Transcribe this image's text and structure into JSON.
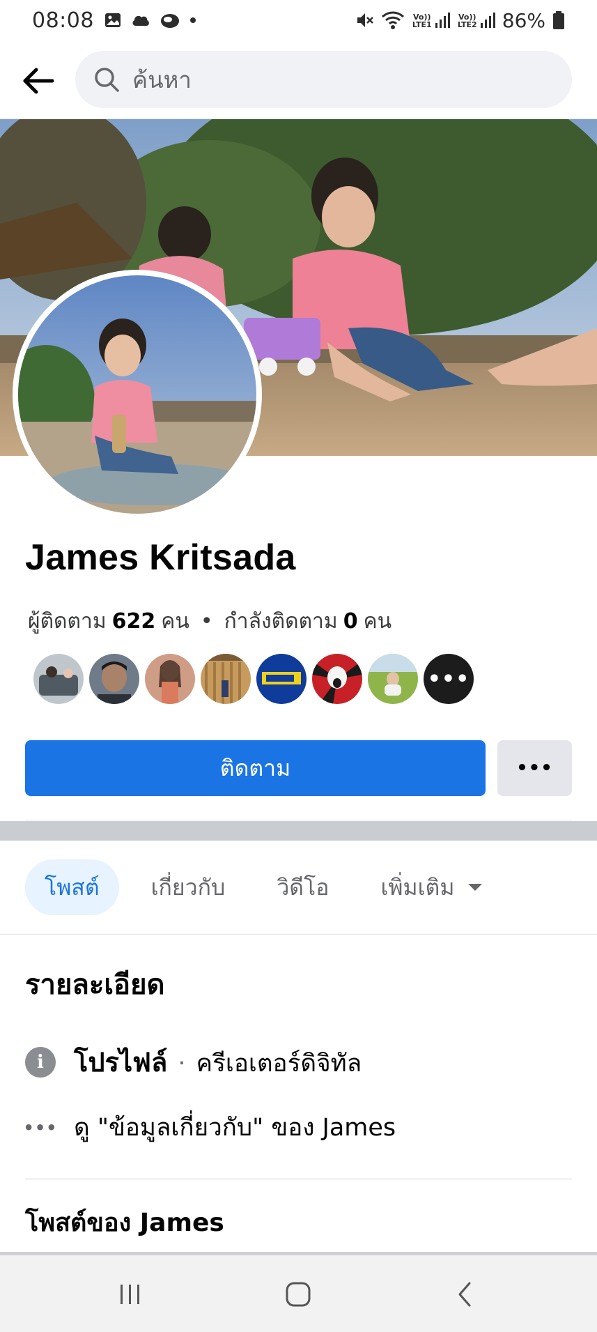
{
  "status_bar": {
    "time": "08:08",
    "battery": "86%",
    "icons": [
      "image-icon",
      "cloud-icon",
      "app-icon",
      "mute-icon",
      "wifi-icon",
      "signal-icon",
      "battery-icon"
    ],
    "sim1_label": "Vo)) LTE1",
    "sim2_label": "Vo)) LTE2"
  },
  "search": {
    "placeholder": "ค้นหา"
  },
  "profile": {
    "name": "James Kritsada",
    "followers_label": "ผู้ติดตาม",
    "followers_count": "622",
    "followers_unit": "คน",
    "following_label": "กำลังติดตาม",
    "following_count": "0",
    "following_unit": "คน",
    "more_followers_label": "•••"
  },
  "actions": {
    "follow_label": "ติดตาม",
    "more_label": "•••"
  },
  "tabs": [
    {
      "label": "โพสต์",
      "active": true
    },
    {
      "label": "เกี่ยวกับ",
      "active": false
    },
    {
      "label": "วิดีโอ",
      "active": false
    },
    {
      "label": "เพิ่มเติม",
      "active": false
    }
  ],
  "details": {
    "title": "รายละเอียด",
    "profile_label": "โปรไฟล์",
    "separator": "·",
    "profile_category": "ครีเอเตอร์ดิจิทัล",
    "about_link": "ดู \"ข้อมูลเกี่ยวกับ\" ของ James"
  },
  "posts": {
    "title": "โพสต์ของ James"
  },
  "colors": {
    "accent": "#1b74e4",
    "tab_active_bg": "#e7f3ff",
    "secondary_btn": "#e4e6eb"
  }
}
